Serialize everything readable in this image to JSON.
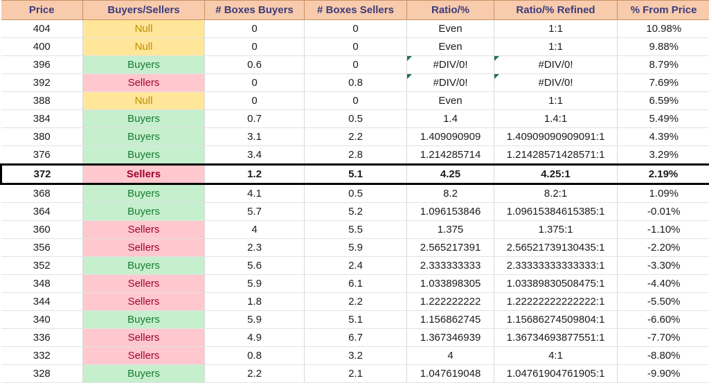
{
  "table": {
    "name": "buyers-sellers-ratio-table",
    "columns": [
      {
        "key": "price",
        "label": "Price"
      },
      {
        "key": "side",
        "label": "Buyers/Sellers"
      },
      {
        "key": "boxes_buy",
        "label": "# Boxes Buyers"
      },
      {
        "key": "boxes_sell",
        "label": "# Boxes Sellers"
      },
      {
        "key": "ratio",
        "label": "Ratio/%"
      },
      {
        "key": "ratio_ref",
        "label": "Ratio/% Refined"
      },
      {
        "key": "pct_from",
        "label": "% From Price"
      }
    ],
    "colors": {
      "header_fill": "#F8CBAD",
      "header_text": "#3B3B7A",
      "null_fill": "#FFE699",
      "null_text": "#BF8F00",
      "buyers_fill": "#C6EFCE",
      "buyers_text": "#187B30",
      "sellers_fill": "#FFC7CE",
      "sellers_text": "#9C0333",
      "focus_border": "#000000",
      "error_marker": "#217346"
    },
    "rows": [
      {
        "price": "404",
        "side": "Null",
        "boxes_buy": "0",
        "boxes_sell": "0",
        "ratio": "Even",
        "ratio_ref": "1:1",
        "pct_from": "10.98%",
        "focus": false,
        "err": false
      },
      {
        "price": "400",
        "side": "Null",
        "boxes_buy": "0",
        "boxes_sell": "0",
        "ratio": "Even",
        "ratio_ref": "1:1",
        "pct_from": "9.88%",
        "focus": false,
        "err": false
      },
      {
        "price": "396",
        "side": "Buyers",
        "boxes_buy": "0.6",
        "boxes_sell": "0",
        "ratio": "#DIV/0!",
        "ratio_ref": "#DIV/0!",
        "pct_from": "8.79%",
        "focus": false,
        "err": true
      },
      {
        "price": "392",
        "side": "Sellers",
        "boxes_buy": "0",
        "boxes_sell": "0.8",
        "ratio": "#DIV/0!",
        "ratio_ref": "#DIV/0!",
        "pct_from": "7.69%",
        "focus": false,
        "err": true
      },
      {
        "price": "388",
        "side": "Null",
        "boxes_buy": "0",
        "boxes_sell": "0",
        "ratio": "Even",
        "ratio_ref": "1:1",
        "pct_from": "6.59%",
        "focus": false,
        "err": false
      },
      {
        "price": "384",
        "side": "Buyers",
        "boxes_buy": "0.7",
        "boxes_sell": "0.5",
        "ratio": "1.4",
        "ratio_ref": "1.4:1",
        "pct_from": "5.49%",
        "focus": false,
        "err": false
      },
      {
        "price": "380",
        "side": "Buyers",
        "boxes_buy": "3.1",
        "boxes_sell": "2.2",
        "ratio": "1.409090909",
        "ratio_ref": "1.40909090909091:1",
        "pct_from": "4.39%",
        "focus": false,
        "err": false
      },
      {
        "price": "376",
        "side": "Buyers",
        "boxes_buy": "3.4",
        "boxes_sell": "2.8",
        "ratio": "1.214285714",
        "ratio_ref": "1.21428571428571:1",
        "pct_from": "3.29%",
        "focus": false,
        "err": false
      },
      {
        "price": "372",
        "side": "Sellers",
        "boxes_buy": "1.2",
        "boxes_sell": "5.1",
        "ratio": "4.25",
        "ratio_ref": "4.25:1",
        "pct_from": "2.19%",
        "focus": true,
        "err": false
      },
      {
        "price": "368",
        "side": "Buyers",
        "boxes_buy": "4.1",
        "boxes_sell": "0.5",
        "ratio": "8.2",
        "ratio_ref": "8.2:1",
        "pct_from": "1.09%",
        "focus": false,
        "err": false
      },
      {
        "price": "364",
        "side": "Buyers",
        "boxes_buy": "5.7",
        "boxes_sell": "5.2",
        "ratio": "1.096153846",
        "ratio_ref": "1.09615384615385:1",
        "pct_from": "-0.01%",
        "focus": false,
        "err": false
      },
      {
        "price": "360",
        "side": "Sellers",
        "boxes_buy": "4",
        "boxes_sell": "5.5",
        "ratio": "1.375",
        "ratio_ref": "1.375:1",
        "pct_from": "-1.10%",
        "focus": false,
        "err": false
      },
      {
        "price": "356",
        "side": "Sellers",
        "boxes_buy": "2.3",
        "boxes_sell": "5.9",
        "ratio": "2.565217391",
        "ratio_ref": "2.56521739130435:1",
        "pct_from": "-2.20%",
        "focus": false,
        "err": false
      },
      {
        "price": "352",
        "side": "Buyers",
        "boxes_buy": "5.6",
        "boxes_sell": "2.4",
        "ratio": "2.333333333",
        "ratio_ref": "2.33333333333333:1",
        "pct_from": "-3.30%",
        "focus": false,
        "err": false
      },
      {
        "price": "348",
        "side": "Sellers",
        "boxes_buy": "5.9",
        "boxes_sell": "6.1",
        "ratio": "1.033898305",
        "ratio_ref": "1.03389830508475:1",
        "pct_from": "-4.40%",
        "focus": false,
        "err": false
      },
      {
        "price": "344",
        "side": "Sellers",
        "boxes_buy": "1.8",
        "boxes_sell": "2.2",
        "ratio": "1.222222222",
        "ratio_ref": "1.22222222222222:1",
        "pct_from": "-5.50%",
        "focus": false,
        "err": false
      },
      {
        "price": "340",
        "side": "Buyers",
        "boxes_buy": "5.9",
        "boxes_sell": "5.1",
        "ratio": "1.156862745",
        "ratio_ref": "1.15686274509804:1",
        "pct_from": "-6.60%",
        "focus": false,
        "err": false
      },
      {
        "price": "336",
        "side": "Sellers",
        "boxes_buy": "4.9",
        "boxes_sell": "6.7",
        "ratio": "1.367346939",
        "ratio_ref": "1.36734693877551:1",
        "pct_from": "-7.70%",
        "focus": false,
        "err": false
      },
      {
        "price": "332",
        "side": "Sellers",
        "boxes_buy": "0.8",
        "boxes_sell": "3.2",
        "ratio": "4",
        "ratio_ref": "4:1",
        "pct_from": "-8.80%",
        "focus": false,
        "err": false
      },
      {
        "price": "328",
        "side": "Buyers",
        "boxes_buy": "2.2",
        "boxes_sell": "2.1",
        "ratio": "1.047619048",
        "ratio_ref": "1.04761904761905:1",
        "pct_from": "-9.90%",
        "focus": false,
        "err": false
      }
    ]
  }
}
